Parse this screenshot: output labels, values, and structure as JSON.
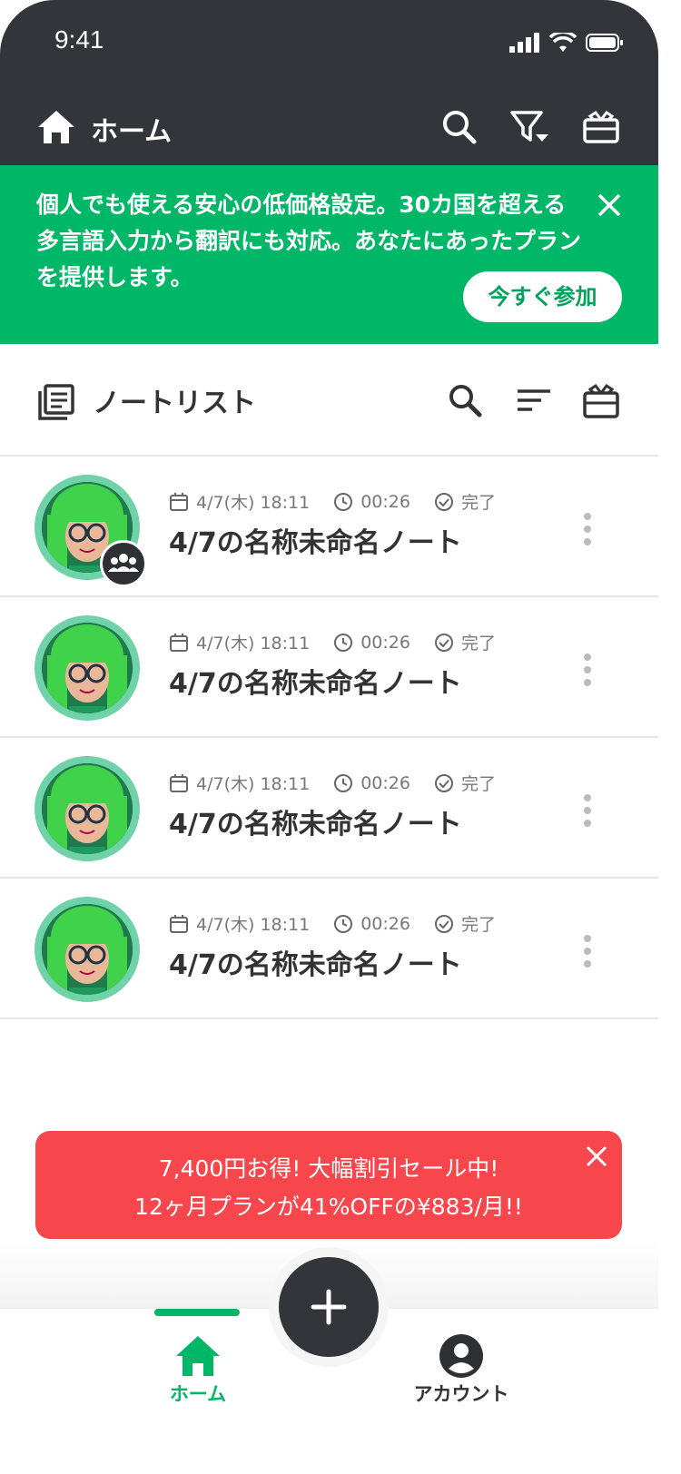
{
  "status_bar": {
    "time": "9:41"
  },
  "app_bar": {
    "title": "ホーム"
  },
  "banner": {
    "text": "個人でも使える安心の低価格設定。30カ国を超える多言語入力から翻訳にも対応。あなたにあったプランを提供します。",
    "button_label": "今すぐ参加"
  },
  "section": {
    "title": "ノートリスト"
  },
  "notes": [
    {
      "date": "4/7(木) 18:11",
      "duration": "00:26",
      "status": "完了",
      "title": "4/7の名称未命名ノート",
      "shared": true
    },
    {
      "date": "4/7(木) 18:11",
      "duration": "00:26",
      "status": "完了",
      "title": "4/7の名称未命名ノート",
      "shared": false
    },
    {
      "date": "4/7(木) 18:11",
      "duration": "00:26",
      "status": "完了",
      "title": "4/7の名称未命名ノート",
      "shared": false
    },
    {
      "date": "4/7(木) 18:11",
      "duration": "00:26",
      "status": "完了",
      "title": "4/7の名称未命名ノート",
      "shared": false
    }
  ],
  "promo": {
    "line1": "7,400円お得! 大幅割引セール中!",
    "line2": "12ヶ月プランが41%OFFの¥883/月!!"
  },
  "bottom_nav": {
    "home_label": "ホーム",
    "account_label": "アカウント"
  },
  "colors": {
    "accent": "#00b667",
    "dark": "#34353a",
    "promo": "#f7474c"
  }
}
